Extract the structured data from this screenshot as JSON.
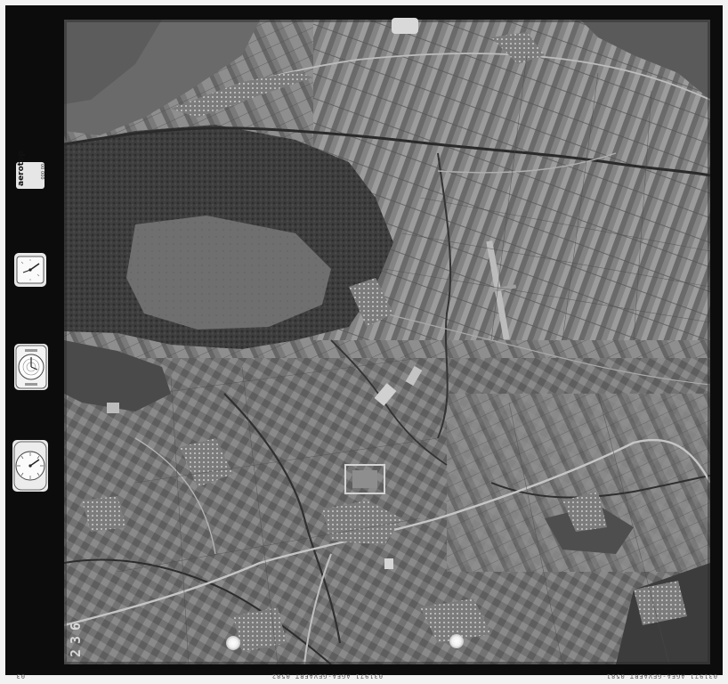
{
  "film": {
    "brand_logo_text": "aerotop",
    "brand_logo_sub": "00 000",
    "frame_number": "236",
    "frame_number_chars": [
      "2",
      "3",
      "6"
    ],
    "edge_print_center": "031971 AGFA-GEVAERT 0582",
    "edge_print_right": "031971 AGFA-GEVAERT 0581",
    "edge_print_left": "03"
  },
  "instruments": [
    {
      "name": "altimeter-gauge"
    },
    {
      "name": "clock-gauge"
    },
    {
      "name": "level-bubble-gauge"
    },
    {
      "name": "counter-dial-gauge"
    }
  ],
  "colors": {
    "film_border": "#0c0c0c",
    "paper": "#f2f2f2",
    "photo_base": "#6c6c6c",
    "forest_dark": "#3a3a3a",
    "field_light": "#9a9a9a",
    "road_light": "#c8c8c8"
  }
}
